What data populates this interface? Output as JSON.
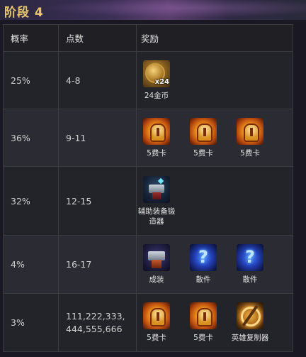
{
  "header": {
    "title": "阶段 4"
  },
  "table": {
    "columns": [
      "概率",
      "点数",
      "奖励"
    ],
    "rows": [
      {
        "probability": "25%",
        "points": "4-8",
        "rewards": [
          {
            "icon": "gold-coin-icon",
            "label": "24金币",
            "quantity": "x24"
          }
        ]
      },
      {
        "probability": "36%",
        "points": "9-11",
        "rewards": [
          {
            "icon": "five-cost-card-icon",
            "label": "5费卡"
          },
          {
            "icon": "five-cost-card-icon",
            "label": "5费卡"
          },
          {
            "icon": "five-cost-card-icon",
            "label": "5费卡"
          }
        ]
      },
      {
        "probability": "32%",
        "points": "12-15",
        "rewards": [
          {
            "icon": "support-anvil-icon",
            "label": "辅助装备锻造器"
          }
        ]
      },
      {
        "probability": "4%",
        "points": "16-17",
        "rewards": [
          {
            "icon": "completed-item-anvil-icon",
            "label": "成装"
          },
          {
            "icon": "component-icon",
            "label": "散件"
          },
          {
            "icon": "component-icon",
            "label": "散件"
          }
        ]
      },
      {
        "probability": "3%",
        "points_lines": [
          "111,222,333,",
          "444,555,666"
        ],
        "rewards": [
          {
            "icon": "five-cost-card-icon",
            "label": "5费卡"
          },
          {
            "icon": "five-cost-card-icon",
            "label": "5费卡"
          },
          {
            "icon": "champion-duplicator-icon",
            "label": "英雄复制器"
          }
        ]
      }
    ]
  }
}
